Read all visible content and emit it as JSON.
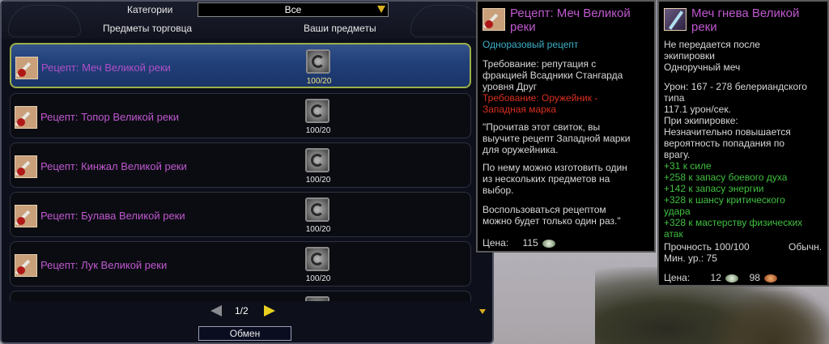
{
  "vendor": {
    "category_label": "Категории",
    "category_value": "Все",
    "col_vendor_items": "Предметы торговца",
    "col_your_items": "Ваши предметы",
    "items": [
      {
        "label": "Рецепт: Меч Великой реки",
        "count": "100/20",
        "selected": true
      },
      {
        "label": "Рецепт: Топор Великой реки",
        "count": "100/20",
        "selected": false
      },
      {
        "label": "Рецепт: Кинжал Великой реки",
        "count": "100/20",
        "selected": false
      },
      {
        "label": "Рецепт: Булава Великой реки",
        "count": "100/20",
        "selected": false
      },
      {
        "label": "Рецепт: Лук Великой реки",
        "count": "100/20",
        "selected": false
      }
    ],
    "page": "1/2",
    "exchange_label": "Обмен"
  },
  "tooltip_recipe": {
    "title": "Рецепт: Меч Великой реки",
    "type": "Одноразовый рецепт",
    "req1": "Требование: репутация с",
    "req2": "фракцией Всадники Стангарда",
    "req3": "уровня Друг",
    "req4": "Требование: Оружейник -",
    "req5": "Западная марка",
    "desc1": "\"Прочитав этот свиток, вы",
    "desc2": "выучите рецепт Западной марки",
    "desc3": "для оружейника.",
    "desc4": "По нему можно изготовить один",
    "desc5": "из нескольких предметов на",
    "desc6": "выбор.",
    "desc7": "Воспользоваться рецептом",
    "desc8": "можно будет только один раз.\"",
    "price_label": "Цена:",
    "price_value": "115"
  },
  "tooltip_sword": {
    "title": "Меч гнева Великой реки",
    "bind1": "Не передается после",
    "bind2": "экипировки",
    "weapon_type": "Одноручный меч",
    "damage1": "Урон: 167 - 278 белериандского",
    "damage2": "типа",
    "dps": "117.1 урон/сек.",
    "equip1": "При экипировке:",
    "equip2": "Незначительно повышается",
    "equip3": "вероятность попадания по",
    "equip4": "врагу.",
    "stat1": "+31 к силе",
    "stat2": "+258 к запасу боевого духа",
    "stat3": "+142 к запасу энергии",
    "stat4": "+328 к шансу критического",
    "stat5": "удара",
    "stat6": "+328 к мастерству физических",
    "stat7": "атак",
    "durability": "Прочность 100/100",
    "quality": "Обычн.",
    "min_level": "Мин. ур.: 75",
    "price_label": "Цена:",
    "price_silver": "12",
    "price_copper": "98"
  }
}
